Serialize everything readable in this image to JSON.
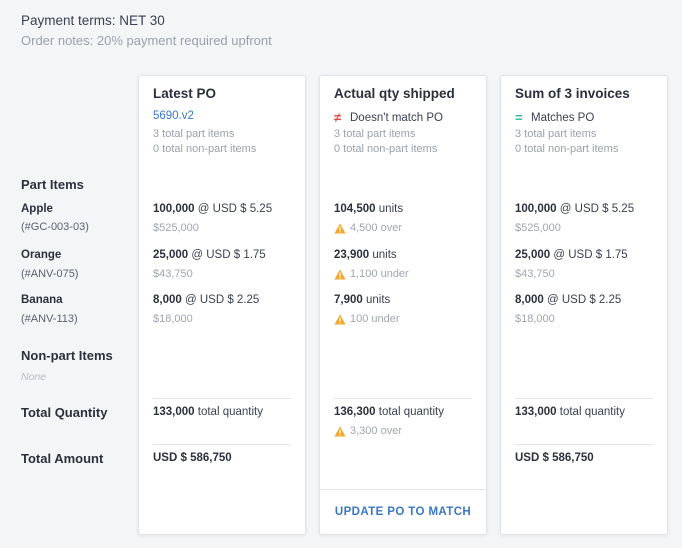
{
  "header": {
    "payment_terms": "Payment terms: NET 30",
    "order_notes": "Order notes: 20% payment required upfront"
  },
  "labels": {
    "part_items": "Part Items",
    "items": [
      {
        "name": "Apple",
        "code": "(#GC-003-03)"
      },
      {
        "name": "Orange",
        "code": "(#ANV-075)"
      },
      {
        "name": "Banana",
        "code": "(#ANV-113)"
      }
    ],
    "non_part_items": "Non-part Items",
    "none": "None",
    "total_quantity": "Total Quantity",
    "total_amount": "Total Amount"
  },
  "columns": [
    {
      "title": "Latest PO",
      "subtitle": "5690.v2",
      "part_count": "3 total part items",
      "nonpart_count": "0 total non-part items",
      "rows": [
        {
          "qty": "100,000",
          "rest": " @ USD $ 5.25",
          "sub": "$525,000"
        },
        {
          "qty": "25,000",
          "rest": " @ USD $ 1.75",
          "sub": "$43,750"
        },
        {
          "qty": "8,000",
          "rest": " @ USD $ 2.25",
          "sub": "$18,000"
        }
      ],
      "total_qty": "133,000",
      "total_qty_label": " total quantity",
      "total_amount": "USD $ 586,750"
    },
    {
      "title": "Actual qty shipped",
      "status_symbol": "≠",
      "status_text": "Doesn't match PO",
      "part_count": "3 total part items",
      "nonpart_count": "0 total non-part items",
      "rows": [
        {
          "qty": "104,500",
          "rest": " units",
          "sub": "4,500 over"
        },
        {
          "qty": "23,900",
          "rest": " units",
          "sub": "1,100 under"
        },
        {
          "qty": "7,900",
          "rest": " units",
          "sub": "100 under"
        }
      ],
      "total_qty": "136,300",
      "total_qty_label": " total quantity",
      "total_warning": "3,300 over",
      "action": "UPDATE PO TO MATCH"
    },
    {
      "title": "Sum of 3 invoices",
      "status_symbol": "=",
      "status_text": "Matches PO",
      "part_count": "3 total part items",
      "nonpart_count": "0 total non-part items",
      "rows": [
        {
          "qty": "100,000",
          "rest": " @ USD $ 5.25",
          "sub": "$525,000"
        },
        {
          "qty": "25,000",
          "rest": " @ USD $ 1.75",
          "sub": "$43,750"
        },
        {
          "qty": "8,000",
          "rest": " @ USD $ 2.25",
          "sub": "$18,000"
        }
      ],
      "total_qty": "133,000",
      "total_qty_label": " total quantity",
      "total_amount": "USD $ 586,750"
    }
  ],
  "colors": {
    "link": "#3a77c4",
    "mismatch": "#e04b4b",
    "match": "#2bb893",
    "warning": "#f0a92e"
  }
}
